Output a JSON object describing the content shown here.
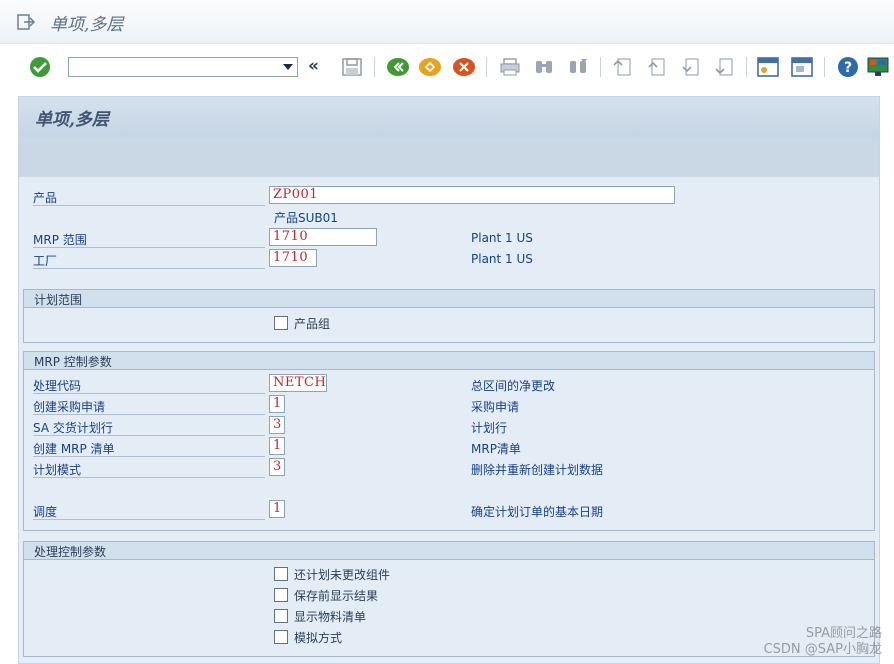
{
  "window": {
    "title": "单项,多层"
  },
  "toolbar": {
    "command_value": "",
    "chevron": "«"
  },
  "panel": {
    "title": "单项,多层"
  },
  "header_fields": {
    "product": {
      "label": "产品",
      "value": "ZP001",
      "desc": "产品SUB01"
    },
    "mrp_area": {
      "label": "MRP 范围",
      "value": "1710",
      "desc": "Plant 1 US"
    },
    "plant": {
      "label": "工厂",
      "value": "1710",
      "desc": "Plant 1 US"
    }
  },
  "planning_scope": {
    "title": "计划范围",
    "product_group": {
      "label": "产品组",
      "checked": false
    }
  },
  "mrp_control": {
    "title": "MRP 控制参数",
    "rows": [
      {
        "label": "处理代码",
        "value": "NETCH",
        "desc": "总区间的净更改"
      },
      {
        "label": "创建采购申请",
        "value": "1",
        "desc": "采购申请"
      },
      {
        "label": "SA 交货计划行",
        "value": "3",
        "desc": "计划行"
      },
      {
        "label": "创建 MRP 清单",
        "value": "1",
        "desc": "MRP清单"
      },
      {
        "label": "计划模式",
        "value": "3",
        "desc": "删除并重新创建计划数据"
      },
      {
        "label": "调度",
        "value": "1",
        "desc": "确定计划订单的基本日期"
      }
    ]
  },
  "process_control": {
    "title": "处理控制参数",
    "options": [
      {
        "label": "还计划未更改组件",
        "checked": false
      },
      {
        "label": "保存前显示结果",
        "checked": false
      },
      {
        "label": "显示物料清单",
        "checked": false
      },
      {
        "label": "模拟方式",
        "checked": false
      }
    ]
  },
  "watermark": {
    "line1": "SPA顾问之路",
    "line2": "CSDN @SAP小胸龙"
  },
  "colors": {
    "field_value": "#c4242a",
    "label": "#16408a",
    "panel_bg": "#e4edf6"
  }
}
